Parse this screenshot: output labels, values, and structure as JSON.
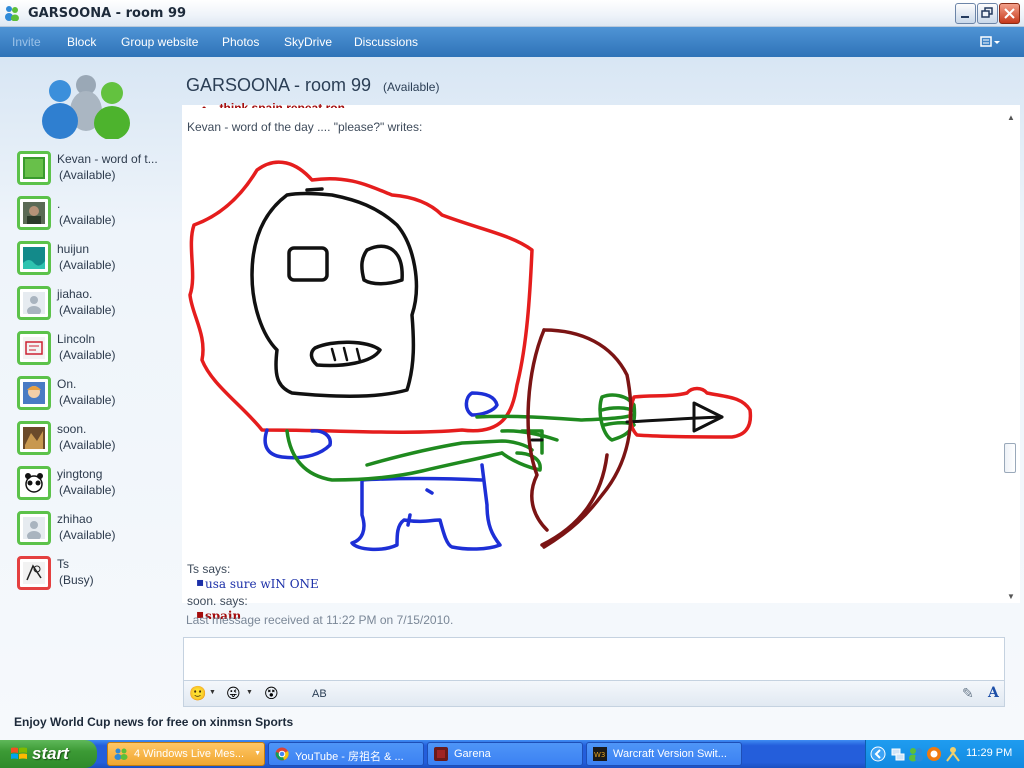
{
  "window": {
    "title": "GARSOONA - room 99"
  },
  "menu": {
    "items": [
      {
        "label": "Invite",
        "disabled": true
      },
      {
        "label": "Block",
        "disabled": false
      },
      {
        "label": "Group website",
        "disabled": false
      },
      {
        "label": "Photos",
        "disabled": false
      },
      {
        "label": "SkyDrive",
        "disabled": false
      },
      {
        "label": "Discussions",
        "disabled": false
      }
    ]
  },
  "conversation": {
    "title": "GARSOONA - room 99",
    "status": "(Available)",
    "partial_top_line": "• ...think spain repeat ron",
    "ink_sender": "Kevan - word of the day .... \"please?\" writes:",
    "messages": [
      {
        "sender": "Ts says:",
        "text": "usa sure wIN ONE",
        "color": "#1b2fa8"
      },
      {
        "sender": "soon. says:",
        "text": "spain",
        "color": "#a40c0c"
      }
    ],
    "last_message": "Last message received at 11:22 PM on 7/15/2010."
  },
  "contacts": [
    {
      "name": "Kevan - word of t...",
      "status": "(Available)",
      "pic": "green"
    },
    {
      "name": ".",
      "status": "(Available)",
      "pic": "photo"
    },
    {
      "name": "huijun",
      "status": "(Available)",
      "pic": "aqua"
    },
    {
      "name": "jiahao.",
      "status": "(Available)",
      "pic": "silhouette"
    },
    {
      "name": "Lincoln",
      "status": "(Available)",
      "pic": "card"
    },
    {
      "name": "On.",
      "status": "(Available)",
      "pic": "anime"
    },
    {
      "name": "soon.",
      "status": "(Available)",
      "pic": "game"
    },
    {
      "name": "yingtong",
      "status": "(Available)",
      "pic": "panda"
    },
    {
      "name": "zhihao",
      "status": "(Available)",
      "pic": "silhouette"
    },
    {
      "name": "Ts",
      "status": "(Busy)",
      "pic": "sketch"
    }
  ],
  "ad": {
    "text": "Enjoy World Cup news for free on xinmsn Sports"
  },
  "taskbar": {
    "start_label": "start",
    "tasks": [
      {
        "label": "4 Windows Live Mes...",
        "icon": "messenger-icon",
        "active": true
      },
      {
        "label": "YouTube - 房祖名 & ...",
        "icon": "chrome-icon",
        "active": false
      },
      {
        "label": "Garena",
        "icon": "garena-icon",
        "active": false
      },
      {
        "label": "Warcraft Version Swit...",
        "icon": "warcraft-icon",
        "active": false
      }
    ],
    "clock": "11:29 PM"
  }
}
